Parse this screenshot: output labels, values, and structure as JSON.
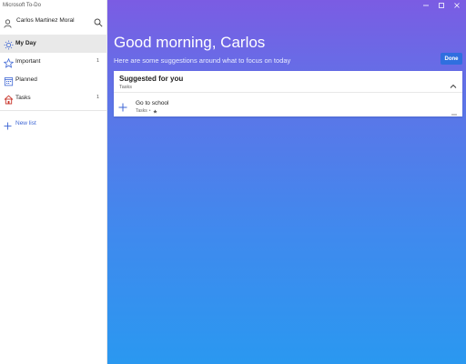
{
  "app": {
    "title": "Microsoft To-Do",
    "accent": "#3e66d4"
  },
  "user": {
    "name": "Carlos Martinez Moral"
  },
  "nav": {
    "items": [
      {
        "label": "My Day",
        "count": "",
        "icon": "sun-icon",
        "active": true
      },
      {
        "label": "Important",
        "count": "1",
        "icon": "star-icon"
      },
      {
        "label": "Planned",
        "count": "",
        "icon": "calendar-icon"
      },
      {
        "label": "Tasks",
        "count": "1",
        "icon": "home-icon"
      }
    ],
    "new_list_label": "New list"
  },
  "main": {
    "greeting": "Good morning, Carlos",
    "subtitle": "Here are some suggestions around what to focus on today",
    "done_label": "Done",
    "background_top": "#7b5ce3",
    "background_bottom": "#2a98f0"
  },
  "suggestions": {
    "title": "Suggested for you",
    "subtitle": "Tasks",
    "tasks": [
      {
        "title": "Go to school",
        "list": "Tasks",
        "dot": "•",
        "starred": true
      }
    ]
  }
}
